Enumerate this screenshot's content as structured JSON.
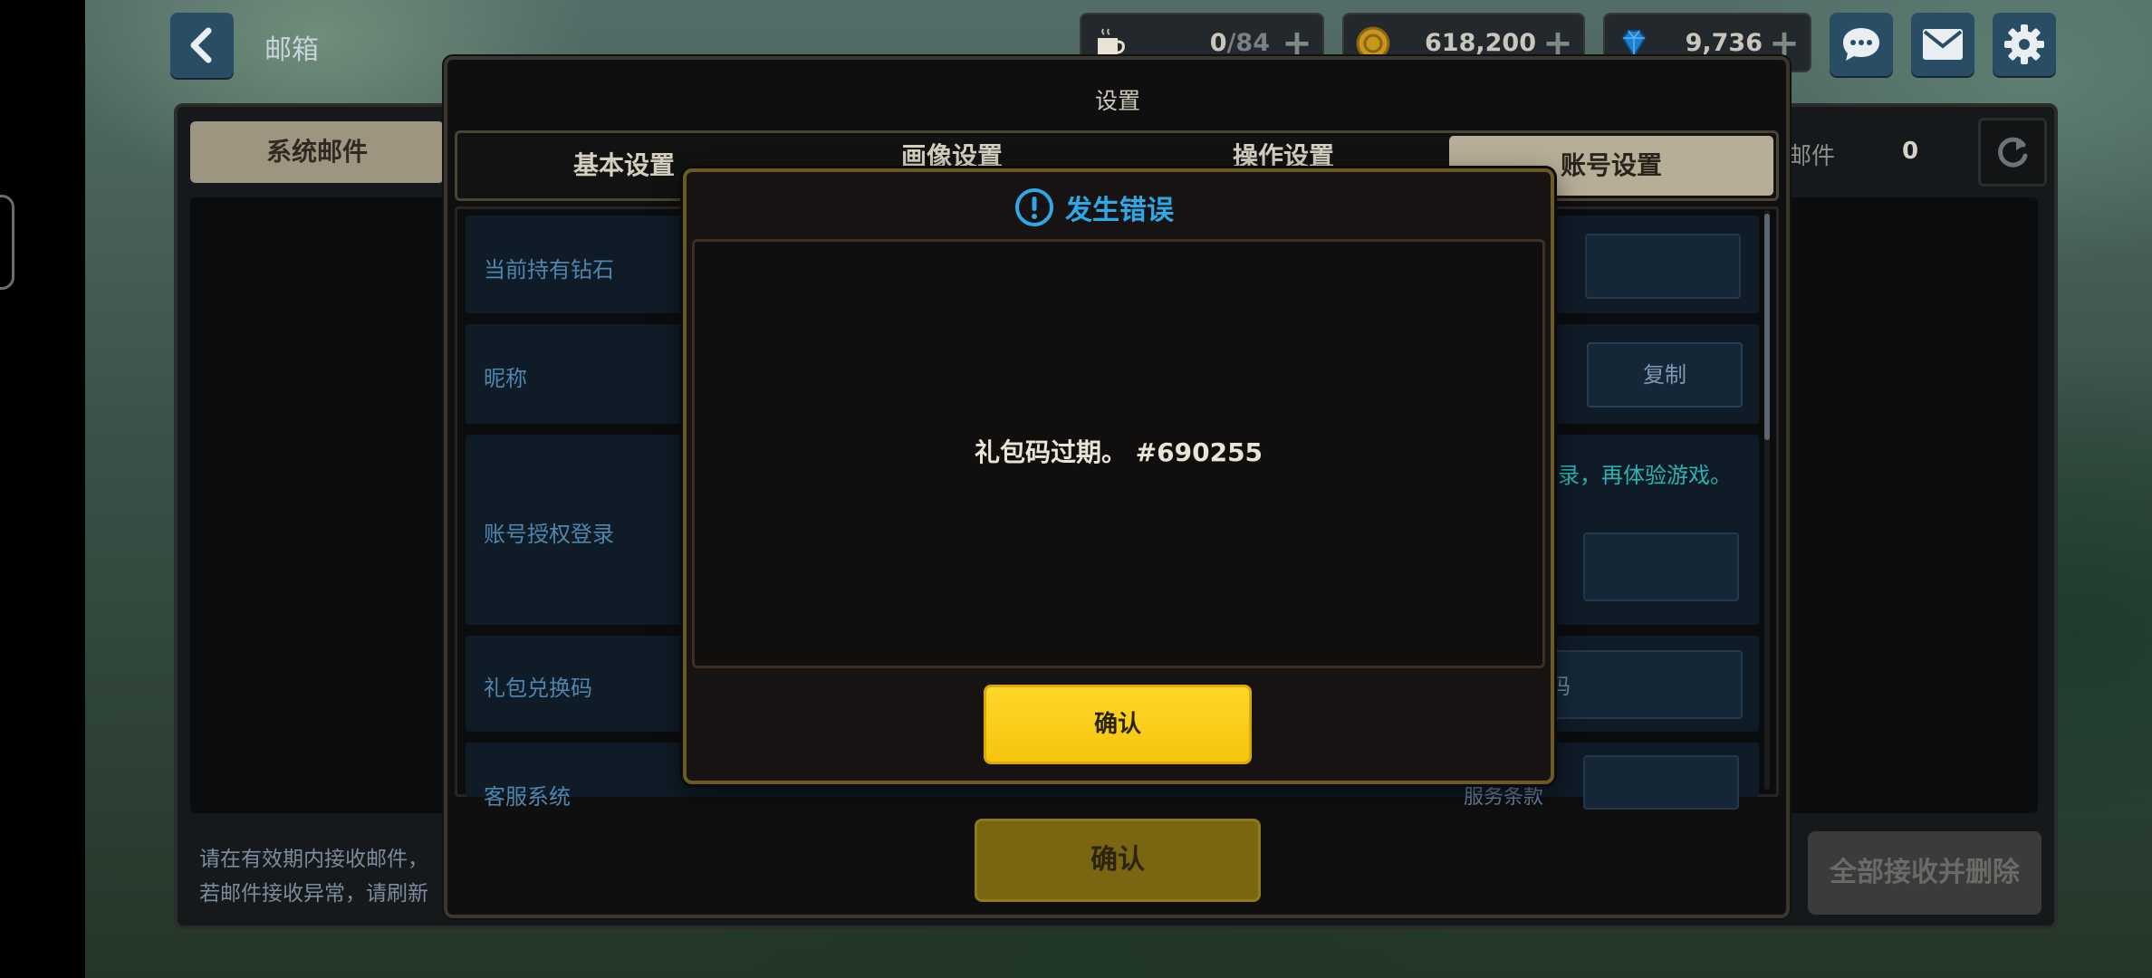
{
  "header": {
    "title": "邮箱",
    "stamina": {
      "value": "0",
      "max": "/84"
    },
    "gold": "618,200",
    "diamonds": "9,736"
  },
  "mailbox": {
    "tab_system": "系统邮件",
    "count_label": "邮件",
    "count_value": "0",
    "notice_line1": "请在有效期内接收邮件，",
    "notice_line2": "若邮件接收异常，请刷新",
    "receive_all_label": "全部接收并删除"
  },
  "settings": {
    "title": "设置",
    "tabs": [
      "基本设置",
      "画像设置",
      "操作设置",
      "账号设置"
    ],
    "rows": [
      {
        "label": "当前持有钻石"
      },
      {
        "label": "昵称"
      },
      {
        "label": "账号授权登录"
      },
      {
        "label": "礼包兑换码"
      },
      {
        "label": "客服系统"
      }
    ],
    "copy_label": "复制",
    "auth_hint": "录，再体验游戏。",
    "redeem_field_text": "码",
    "service_link_text": "服务条款",
    "confirm_label": "确认"
  },
  "error_dialog": {
    "title": "发生错误",
    "message": "礼包码过期。 #690255",
    "confirm_label": "确认"
  },
  "colors": {
    "accent_yellow": "#ffd72a",
    "error_blue": "#2ea8e6",
    "label_blue": "#4f86ad",
    "hint_teal": "#2bb3b3"
  },
  "icons": [
    "back-arrow-icon",
    "coffee-cup-icon",
    "gold-coin-icon",
    "diamond-icon",
    "chat-bubble-icon",
    "mail-icon",
    "gear-icon",
    "refresh-icon",
    "exclamation-circle-icon"
  ]
}
